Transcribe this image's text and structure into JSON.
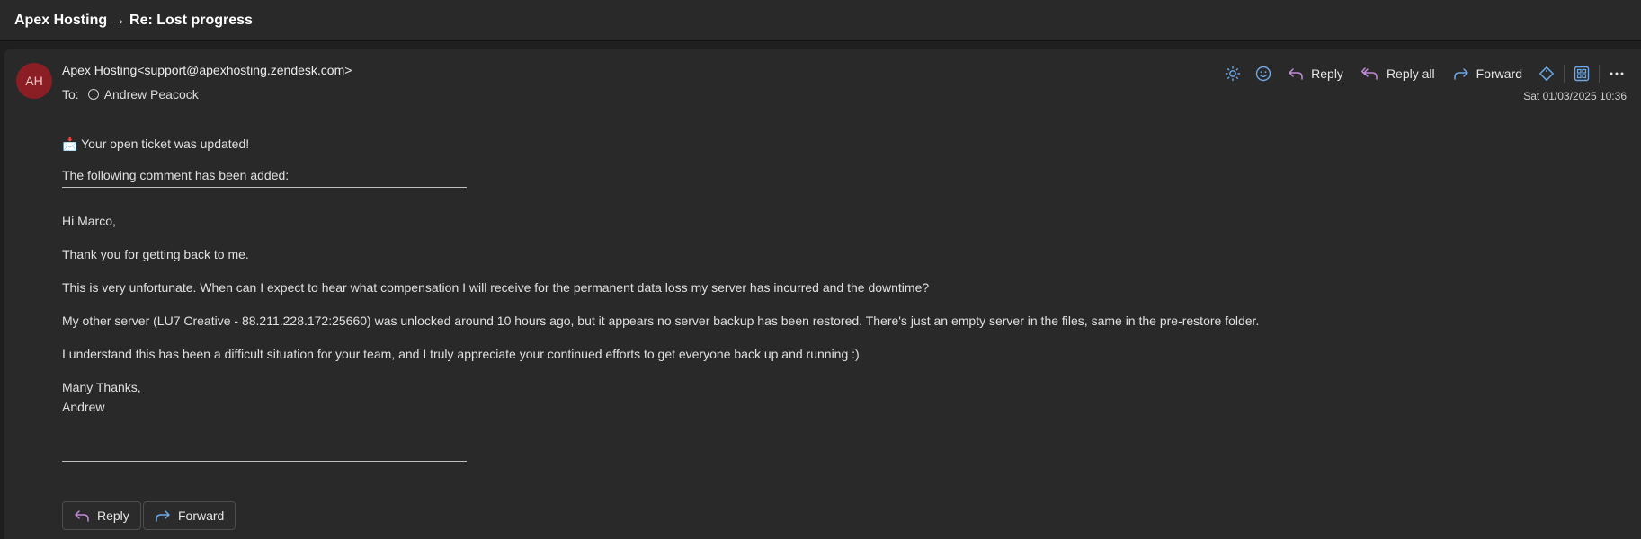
{
  "window": {
    "title": "Apex Hosting → Re: Lost progress"
  },
  "message": {
    "avatar_initials": "AH",
    "sender": "Apex Hosting<support@apexhosting.zendesk.com>",
    "to_label": "To:",
    "recipient": "Andrew Peacock",
    "date": "Sat 01/03/2025 10:36"
  },
  "toolbar": {
    "reply_label": "Reply",
    "reply_all_label": "Reply all",
    "forward_label": "Forward",
    "icons": [
      "sun-icon",
      "emoji-icon",
      "reply-icon",
      "reply-all-icon",
      "forward-icon",
      "tag-icon",
      "apps-icon",
      "more-icon"
    ]
  },
  "body": {
    "notice": "📩 Your open ticket was updated!",
    "comment_intro": "The following comment has been added:",
    "greeting": "Hi Marco,",
    "para1": "Thank you for getting back to me.",
    "para2": "This is very unfortunate. When can I expect to hear what compensation I will receive for the permanent data loss my server has incurred and the downtime?",
    "para3": "My other server (LU7 Creative - 88.211.228.172:25660) was unlocked around 10 hours ago, but it appears no server backup has been restored. There's just an empty server in the files, same in the pre-restore folder.",
    "para4": "I understand this has been a difficult situation for your team, and I truly appreciate your continued efforts to get everyone back up and running :)",
    "signoff1": "Many Thanks,",
    "signoff2": "Andrew"
  },
  "footer": {
    "reply_label": "Reply",
    "forward_label": "Forward"
  },
  "colors": {
    "avatar_bg": "#8b1e24",
    "accent_purple": "#c18bd8",
    "accent_blue": "#6ea8e8",
    "background": "#292929"
  }
}
